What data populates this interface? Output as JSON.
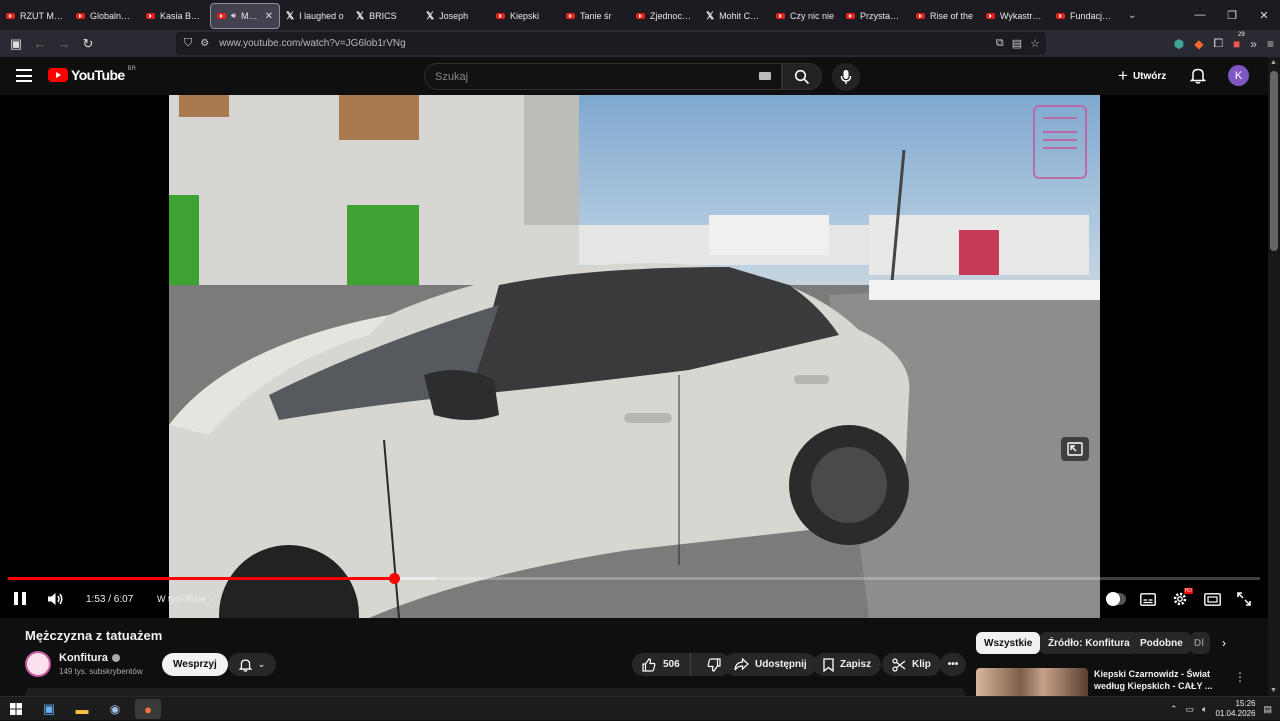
{
  "browser": {
    "tabs": [
      {
        "title": "RZUT MON",
        "icon": "youtube-icon"
      },
      {
        "title": "Globalne In",
        "icon": "youtube-icon"
      },
      {
        "title": "Kasia Babis",
        "icon": "youtube-icon"
      },
      {
        "title": "Mężc",
        "icon": "youtube-icon",
        "active": true
      },
      {
        "title": "I laughed o",
        "icon": "x-icon"
      },
      {
        "title": "BRICS",
        "icon": "x-icon"
      },
      {
        "title": "Joseph",
        "icon": "x-icon"
      },
      {
        "title": "Kiepski",
        "icon": "youtube-icon"
      },
      {
        "title": "Tanie śr",
        "icon": "youtube-icon"
      },
      {
        "title": "Zjednoczeni",
        "icon": "youtube-icon"
      },
      {
        "title": "Mohit Chau",
        "icon": "x-icon"
      },
      {
        "title": "Czy nic nie",
        "icon": "youtube-icon"
      },
      {
        "title": "Przystanek",
        "icon": "youtube-icon"
      },
      {
        "title": "Rise of the",
        "icon": "youtube-icon"
      },
      {
        "title": "Wykastrowa",
        "icon": "youtube-icon"
      },
      {
        "title": "Fundacja EC",
        "icon": "youtube-icon"
      }
    ],
    "url": "www.youtube.com/watch?v=JG6lob1rVNg",
    "extension_badge": "29"
  },
  "youtube": {
    "logo_text": "YouTube",
    "region": "BR",
    "search_placeholder": "Szukaj",
    "create_label": "Utwórz",
    "avatar_letter": "K"
  },
  "player": {
    "time_text": "1:53 / 6:07",
    "progress": 0.308,
    "buffered": 0.342,
    "chapter_label": "W tym filmie",
    "quality_badge": "HD"
  },
  "video": {
    "title": "Mężczyzna z tatuażem",
    "channel_name": "Konfitura",
    "subscribers": "149 tys. subskrybentów",
    "support_label": "Wesprzyj",
    "like_count": "506",
    "share_label": "Udostępnij",
    "save_label": "Zapisz",
    "clip_label": "Klip"
  },
  "sidebar": {
    "chips": [
      "Wszystkie",
      "Źródło: Konfitura",
      "Podobne",
      "Dl"
    ],
    "recommendation_title": "Kiepski Czarnowidz - Świat według Kiepskich - CAŁY ..."
  },
  "taskbar": {
    "time": "15:26",
    "date": "01.04.2026"
  },
  "colors": {
    "accent": "#ff0000",
    "background": "#0f0f0f",
    "watermark": "#c45a9d"
  }
}
